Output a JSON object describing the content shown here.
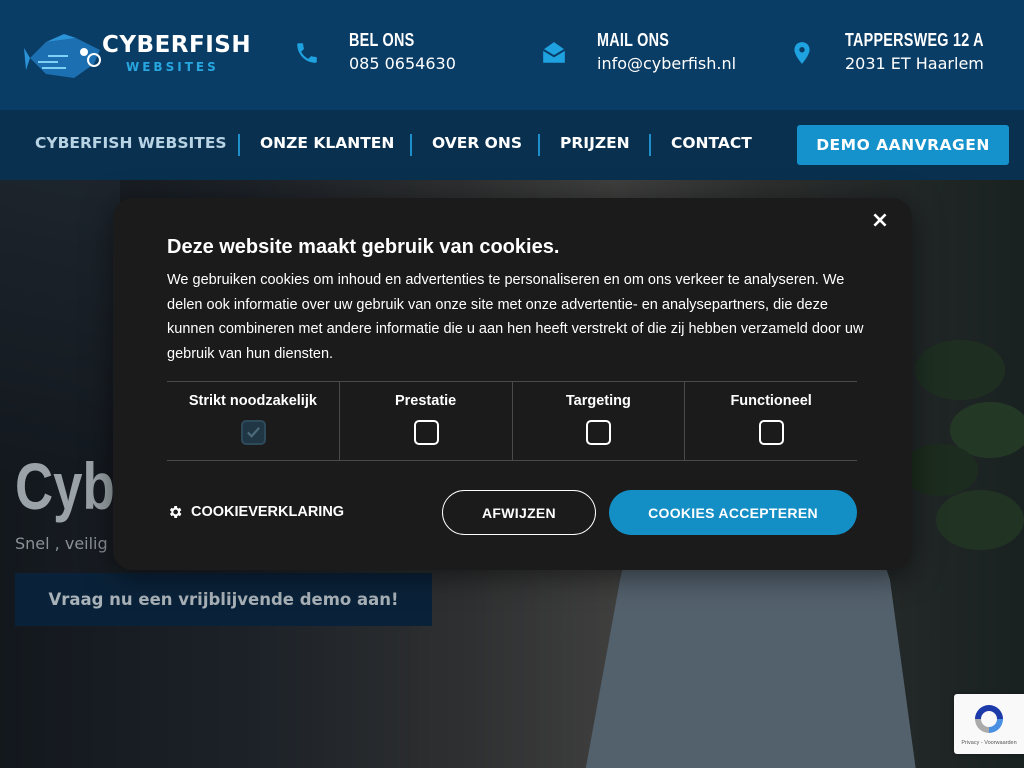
{
  "logo": {
    "title": "CYBERFISH",
    "subtitle": "WEBSITES"
  },
  "contacts": [
    {
      "icon": "phone-icon",
      "title": "BEL ONS",
      "value": "085 0654630"
    },
    {
      "icon": "mail-icon",
      "title": "MAIL ONS",
      "value": "info@cyberfish.nl"
    },
    {
      "icon": "location-pin-icon",
      "title": "TAPPERSWEG 12 A",
      "value": "2031 ET Haarlem"
    }
  ],
  "nav": {
    "items": [
      {
        "label": "CYBERFISH WEBSITES",
        "active": true
      },
      {
        "label": "ONZE KLANTEN"
      },
      {
        "label": "OVER ONS"
      },
      {
        "label": "PRIJZEN"
      },
      {
        "label": "CONTACT"
      }
    ],
    "cta": "DEMO AANVRAGEN"
  },
  "hero": {
    "title": "Cybe",
    "subtitle": "Snel , veilig e",
    "cta": "Vraag nu een vrijblijvende demo aan!"
  },
  "cookie": {
    "close": "×",
    "title": "Deze website maakt gebruik van cookies.",
    "body": "We gebruiken cookies om inhoud en advertenties te personaliseren en om ons verkeer te analyseren. We delen ook informatie over uw gebruik van onze site met onze advertentie- en analysepartners, die deze kunnen combineren met andere informatie die u aan hen heeft verstrekt of die zij hebben verzameld door uw gebruik van hun diensten.",
    "categories": [
      {
        "label": "Strikt noodzakelijk",
        "checked": true,
        "locked": true
      },
      {
        "label": "Prestatie",
        "checked": false
      },
      {
        "label": "Targeting",
        "checked": false
      },
      {
        "label": "Functioneel",
        "checked": false
      }
    ],
    "declaration": "COOKIEVERKLARING",
    "reject": "AFWIJZEN",
    "accept": "COOKIES ACCEPTEREN"
  },
  "recaptcha": {
    "footer": "Privacy - Voorwaarden"
  },
  "colors": {
    "header_bg": "#0a3d66",
    "nav_bg": "#09314f",
    "accent": "#1592cc",
    "modal_bg": "#1b1b1b"
  }
}
